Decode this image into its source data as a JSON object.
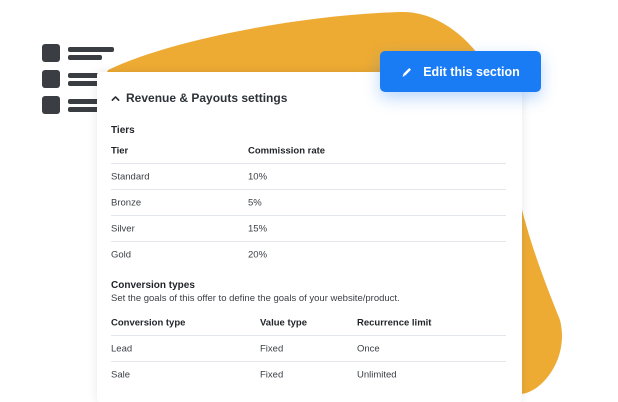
{
  "colors": {
    "blob": "#eeab33",
    "accent": "#1a7cf5",
    "glyph": "#3a3d42"
  },
  "icons": {
    "list": "list-icon",
    "chevron": "chevron-up-icon",
    "edit": "pencil-icon"
  },
  "edit_button": {
    "label": "Edit this section"
  },
  "card": {
    "title": "Revenue & Payouts settings",
    "tiers": {
      "heading": "Tiers",
      "columns": [
        "Tier",
        "Commission rate"
      ],
      "rows": [
        [
          "Standard",
          "10%"
        ],
        [
          "Bronze",
          "5%"
        ],
        [
          "Silver",
          "15%"
        ],
        [
          "Gold",
          "20%"
        ]
      ]
    },
    "conversion": {
      "heading": "Conversion types",
      "description": "Set the goals of this offer to define the goals of your website/product.",
      "columns": [
        "Conversion type",
        "Value type",
        "Recurrence limit"
      ],
      "rows": [
        [
          "Lead",
          "Fixed",
          "Once"
        ],
        [
          "Sale",
          "Fixed",
          "Unlimited"
        ]
      ]
    }
  }
}
